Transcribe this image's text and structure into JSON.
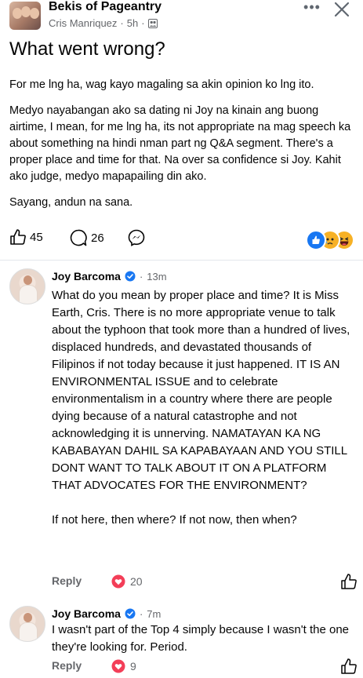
{
  "header": {
    "group_name": "Bekis of Pageantry",
    "author": "Cris Manriquez",
    "time": "5h",
    "more_label": "•••"
  },
  "post": {
    "title": "What went wrong?",
    "paragraphs": [
      "For me lng ha, wag kayo magaling sa akin opinion ko lng ito.",
      "Medyo nayabangan ako sa dating ni Joy na kinain ang buong airtime, I mean, for me lng ha, its not appropriate na mag speech ka about something na hindi nman part ng Q&A segment. There's a proper place and time for that. Na over sa confidence si Joy. Kahit ako judge, medyo mapapailing din ako.",
      "Sayang, andun na sana."
    ],
    "likes": "45",
    "comments": "26",
    "reaction_icons": [
      "like-icon",
      "sad-icon",
      "haha-icon"
    ]
  },
  "comments": [
    {
      "name": "Joy Barcoma",
      "time": "13m",
      "paragraphs": [
        "What do you mean by proper place and time? It is Miss Earth, Cris. There is no more appropriate venue to talk about the typhoon that took more than  a hundred of lives, displaced hundreds, and devastated thousands of Filipinos if not today because it just happened. IT IS AN ENVIRONMENTAL ISSUE and to celebrate environmentalism in a country where there are people dying because of a natural catastrophe and not acknowledging it is unnerving. NAMATAYAN KA NG KABABAYAN DAHIL SA KAPABAYAAN AND YOU STILL DONT WANT TO TALK ABOUT IT ON A PLATFORM THAT ADVOCATES FOR THE ENVIRONMENT?",
        "If not here, then where? If not now, then when?"
      ],
      "reply_label": "Reply",
      "hearts": "20"
    },
    {
      "name": "Joy Barcoma",
      "time": "7m",
      "paragraphs": [
        "I wasn't part of the Top 4 simply because I wasn't the one they're looking for. Period."
      ],
      "reply_label": "Reply",
      "hearts": "9"
    }
  ],
  "colors": {
    "text": "#050505",
    "secondary": "#65676b",
    "verified": "#1877f2",
    "heart": "#f33e58",
    "like_blue": "#1877f2",
    "emoji_yellow": "#f7b125"
  }
}
